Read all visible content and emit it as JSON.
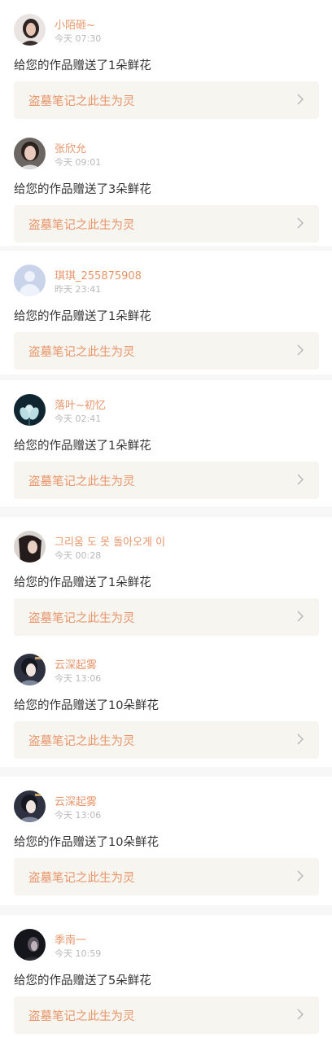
{
  "message_template_note": "",
  "notifications": [
    {
      "username": "小陌砸~",
      "time": "今天 07:30",
      "message": "给您的作品赠送了1朵鲜花",
      "work_title": "盗墓笔记之此生为灵",
      "avatar": "woman-portrait-avatar"
    },
    {
      "username": "张欣允",
      "time": "今天 09:01",
      "message": "给您的作品赠送了3朵鲜花",
      "work_title": "盗墓笔记之此生为灵",
      "avatar": "girl-photo-avatar"
    },
    {
      "username": "琪琪_255875908",
      "time": "昨天 23:41",
      "message": "给您的作品赠送了1朵鲜花",
      "work_title": "盗墓笔记之此生为灵",
      "avatar": "default-user-avatar"
    },
    {
      "username": "落叶~初忆",
      "time": "今天 02:41",
      "message": "给您的作品赠送了1朵鲜花",
      "work_title": "盗墓笔记之此生为灵",
      "avatar": "lotus-flower-avatar"
    },
    {
      "username": "그리움 도 못 돌아오게 이",
      "time": "今天 00:28",
      "message": "给您的作品赠送了1朵鲜花",
      "work_title": "盗墓笔记之此生为灵",
      "avatar": "dark-hair-portrait-avatar"
    },
    {
      "username": "云深起雾",
      "time": "今天 13:06",
      "message": "给您的作品赠送了10朵鲜花",
      "work_title": "盗墓笔记之此生为灵",
      "avatar": "illustrated-character-avatar"
    },
    {
      "username": "云深起雾",
      "time": "今天 13:06",
      "message": "给您的作品赠送了10朵鲜花",
      "work_title": "盗墓笔记之此生为灵",
      "avatar": "illustrated-character-avatar"
    },
    {
      "username": "季南一",
      "time": "今天 10:59",
      "message": "给您的作品赠送了5朵鲜花",
      "work_title": "盗墓笔记之此生为灵",
      "avatar": "dark-night-portrait-avatar"
    }
  ],
  "colors": {
    "accent": "#e8956a",
    "link_bg": "#f6f5f0",
    "text": "#333333",
    "muted": "#b9b9b9",
    "page_bg": "#f7f7f7"
  }
}
